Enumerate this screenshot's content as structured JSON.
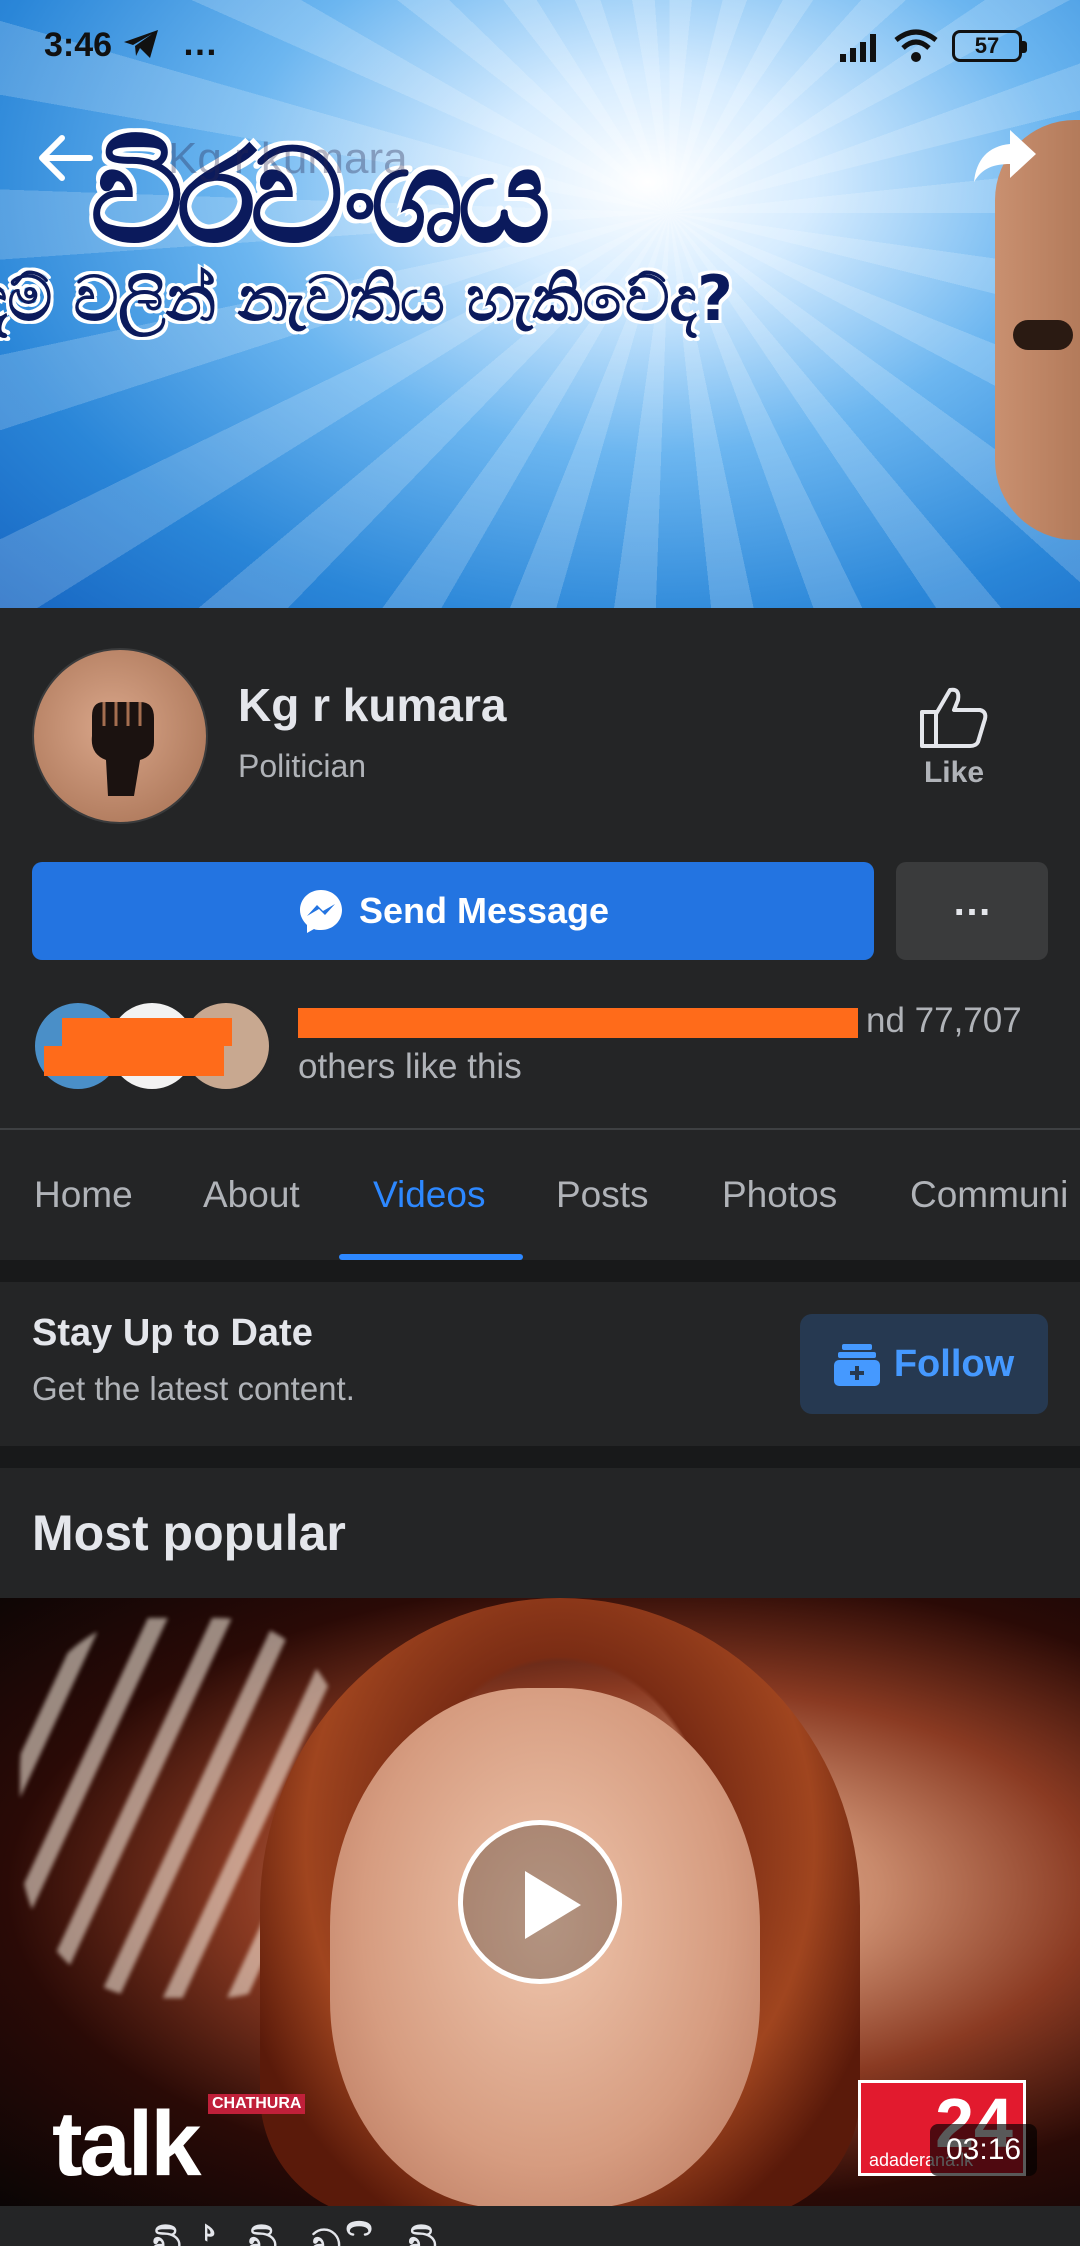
{
  "status_bar": {
    "time": "3:46",
    "more": "…",
    "battery": "57"
  },
  "cover": {
    "search_text": "Kg r kumara",
    "headline": "විරවංශය",
    "subline": "දම් වලින් නැවතිය හැකිවේද?"
  },
  "profile": {
    "name": "Kg r kumara",
    "category": "Politician",
    "like_label": "Like",
    "send_message_label": "Send Message",
    "more_label": "…",
    "likes_text_line1": "nd 77,707",
    "likes_text_line2": "others like this"
  },
  "tabs": [
    {
      "label": "Home"
    },
    {
      "label": "About"
    },
    {
      "label": "Videos",
      "active": true
    },
    {
      "label": "Posts"
    },
    {
      "label": "Photos"
    },
    {
      "label": "Communi"
    }
  ],
  "stay_up_to_date": {
    "title": "Stay Up to Date",
    "subtitle": "Get the latest content.",
    "follow_label": "Follow"
  },
  "most_popular": {
    "heading": "Most popular",
    "video": {
      "duration": "03:16",
      "logo_text": "talk",
      "logo_tag": "CHATHURA",
      "channel_number": "24",
      "channel_url": "adaderana.lk"
    },
    "next_title_fragment": "වි ් වි  ව  ි  වි"
  },
  "colors": {
    "background": "#18191a",
    "card": "#242526",
    "accent": "#2d88ff",
    "send_button": "#2374e1",
    "follow_bg": "#263951",
    "redaction": "#ff6b1a"
  }
}
